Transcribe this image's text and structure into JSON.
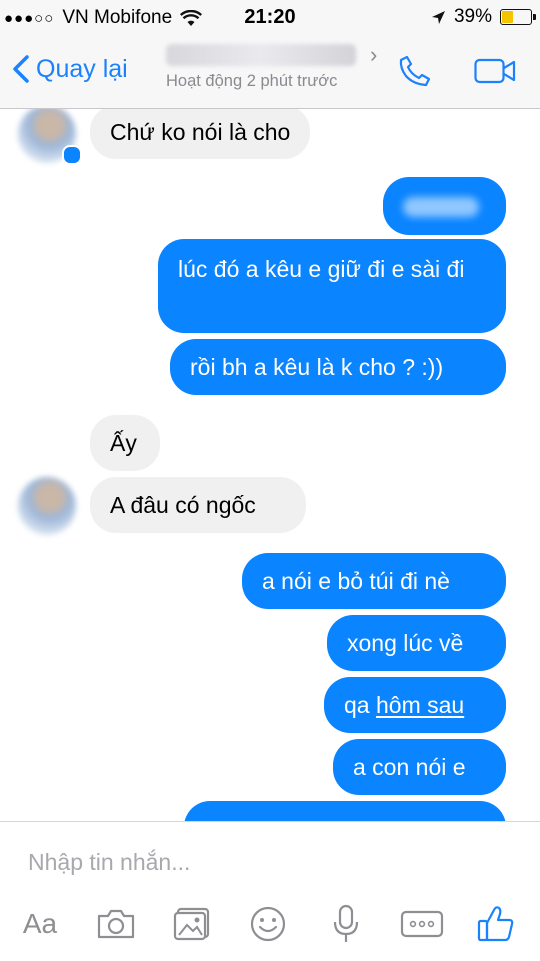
{
  "status_bar": {
    "carrier": "VN Mobifone",
    "time": "21:20",
    "battery": "39%",
    "battery_level": 0.39
  },
  "header": {
    "back_label": "Quay lại",
    "presence": "Hoạt động 2 phút trước"
  },
  "messages": [
    {
      "from": "them",
      "text": "Chứ ko nói là cho"
    },
    {
      "from": "me",
      "text": ""
    },
    {
      "from": "me",
      "text": "lúc đó a kêu e giữ đi e sài đi"
    },
    {
      "from": "me",
      "text": "rồi bh a kêu là k cho ? :))"
    },
    {
      "from": "them",
      "text": "Ấy"
    },
    {
      "from": "them",
      "text": "A đâu có ngốc"
    },
    {
      "from": "me",
      "text": "a nói e bỏ túi đi nè"
    },
    {
      "from": "me",
      "text": "xong lúc về"
    },
    {
      "from": "me",
      "text": "qa hôm sau",
      "prefix": "qa ",
      "underlined": "hôm sau"
    },
    {
      "from": "me",
      "text": "a con nói e"
    }
  ],
  "composer": {
    "placeholder": "Nhập tin nhắn...",
    "aa_label": "Aa",
    "icons": [
      "text-format-icon",
      "camera-icon",
      "gallery-icon",
      "emoji-icon",
      "microphone-icon",
      "more-icon",
      "like-icon"
    ]
  },
  "colors": {
    "accent": "#1a82fb",
    "outgoing_bubble": "#0a84ff",
    "incoming_bubble": "#f1f0f0",
    "battery": "#f4c400"
  }
}
